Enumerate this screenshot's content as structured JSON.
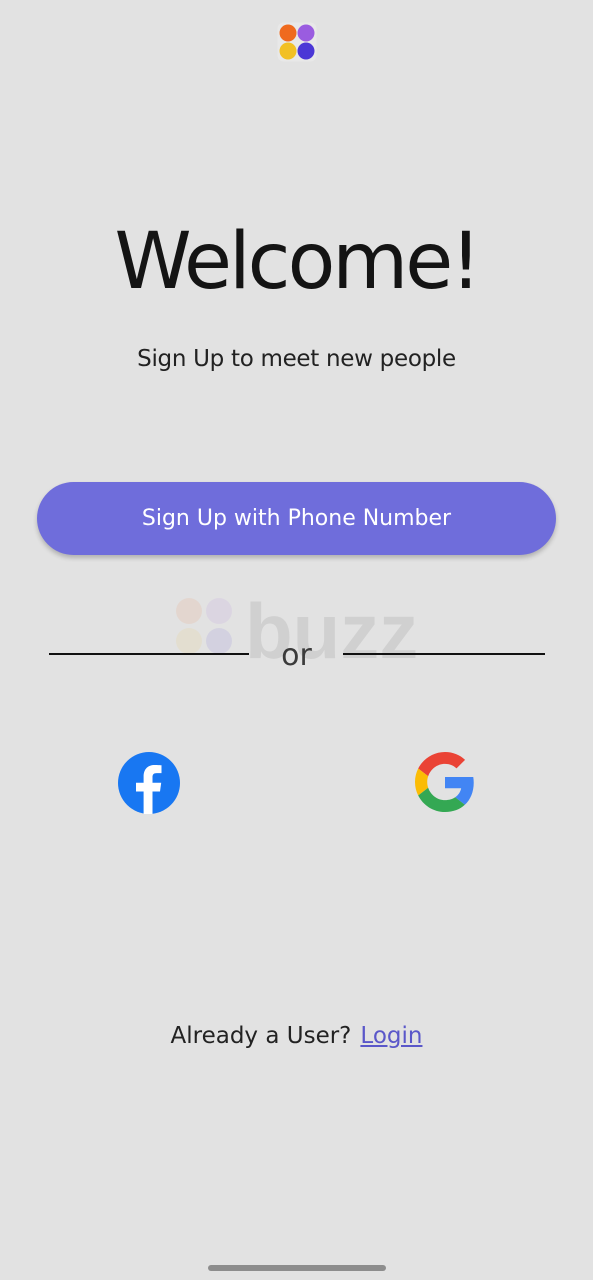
{
  "header": {
    "logo_icon": "buzz-app-logo-icon"
  },
  "hero": {
    "title": "Welcome!",
    "subtitle": "Sign Up to meet new people"
  },
  "actions": {
    "phone_signup_label": "Sign Up with Phone Number",
    "separator_text": "or",
    "social": [
      {
        "name": "facebook-icon",
        "color": "#1877f2"
      },
      {
        "name": "google-icon",
        "colors": [
          "#4285f4",
          "#ea4335",
          "#fbbc05",
          "#34a853"
        ]
      }
    ]
  },
  "watermark": {
    "brand": "buzz"
  },
  "footer": {
    "prompt": "Already a User?",
    "login_label": "Login"
  },
  "colors": {
    "background": "#e2e2e2",
    "primary_button": "#6f6ddb",
    "link": "#5a57c9"
  }
}
